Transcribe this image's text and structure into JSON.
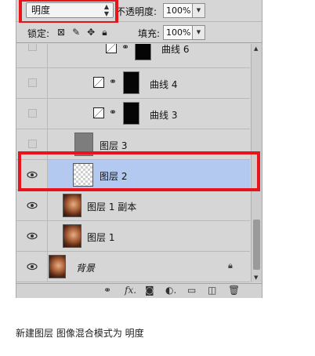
{
  "options_bar": {
    "blend_mode": "明度",
    "opacity_label": "不透明度:",
    "opacity_value": "100%",
    "lock_label": "锁定:",
    "fill_label": "填充:",
    "fill_value": "100%"
  },
  "layers": [
    {
      "name": "曲线 6",
      "visible": false,
      "type": "adjustment"
    },
    {
      "name": "曲线 4",
      "visible": false,
      "type": "adjustment"
    },
    {
      "name": "曲线 3",
      "visible": false,
      "type": "adjustment"
    },
    {
      "name": "图层 3",
      "visible": false,
      "type": "pixel"
    },
    {
      "name": "图层 2",
      "visible": true,
      "type": "pixel",
      "selected": true
    },
    {
      "name": "图层 1 副本",
      "visible": true,
      "type": "photo"
    },
    {
      "name": "图层 1",
      "visible": true,
      "type": "photo"
    },
    {
      "name": "背景",
      "visible": true,
      "type": "background",
      "locked": true
    }
  ],
  "caption": "新建图层 图像混合模式为 明度",
  "colors": {
    "highlight_red": "#e8141b",
    "selected_row": "#b3c9ef",
    "panel_bg": "#d6d6d6"
  },
  "icons": [
    "eye-icon",
    "lock-icon",
    "link-icon",
    "fx-icon",
    "mask-icon",
    "adjustment-icon",
    "folder-icon",
    "new-layer-icon",
    "trash-icon"
  ]
}
